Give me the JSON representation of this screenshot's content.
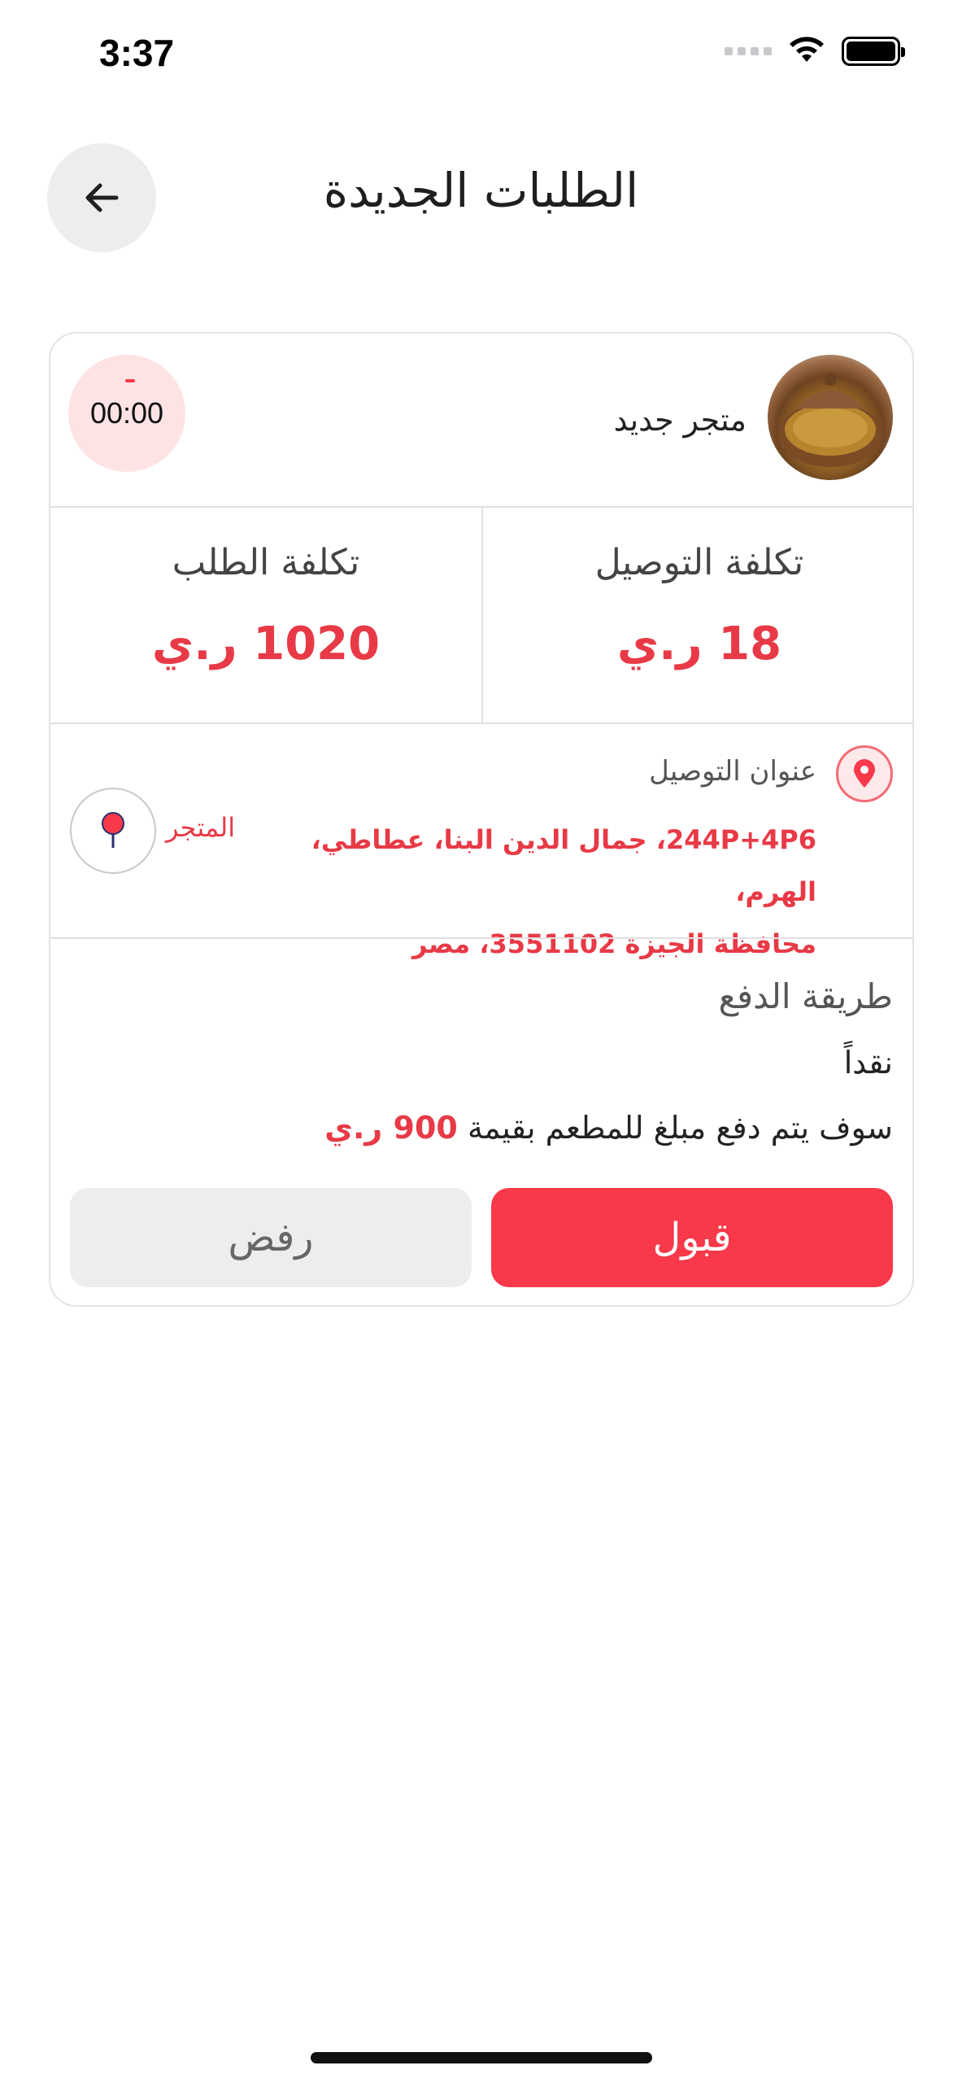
{
  "status_bar": {
    "time": "3:37"
  },
  "header": {
    "title": "الطلبات الجديدة"
  },
  "order_card": {
    "store": {
      "name": "متجر جديد"
    },
    "timer": {
      "value": "00:00"
    },
    "costs": {
      "delivery_label": "تكلفة التوصيل",
      "delivery_value": "18 ر.ي",
      "order_label": "تكلفة الطلب",
      "order_value": "1020 ر.ي"
    },
    "address": {
      "label": "عنوان التوصيل",
      "line1": "244P+4P6، جمال الدين البنا، عطاطي، الهرم،",
      "line2": "محافظة الجيزة 3551102، مصر",
      "store_label": "المتجر"
    },
    "payment": {
      "title": "طريقة الدفع",
      "method": "نقداً",
      "note_prefix": "سوف يتم دفع مبلغ للمطعم بقيمة",
      "note_amount": "900 ر.ي"
    },
    "actions": {
      "accept_label": "قبول",
      "reject_label": "رفض"
    }
  },
  "colors": {
    "accent": "#f7394a",
    "accent_text": "#e83a46",
    "timer_bg": "#fde3e4",
    "neutral_button": "#ededef"
  },
  "icons": {
    "back": "arrow-left-icon",
    "location": "location-pin-icon",
    "store_nav": "map-marker-icon"
  }
}
